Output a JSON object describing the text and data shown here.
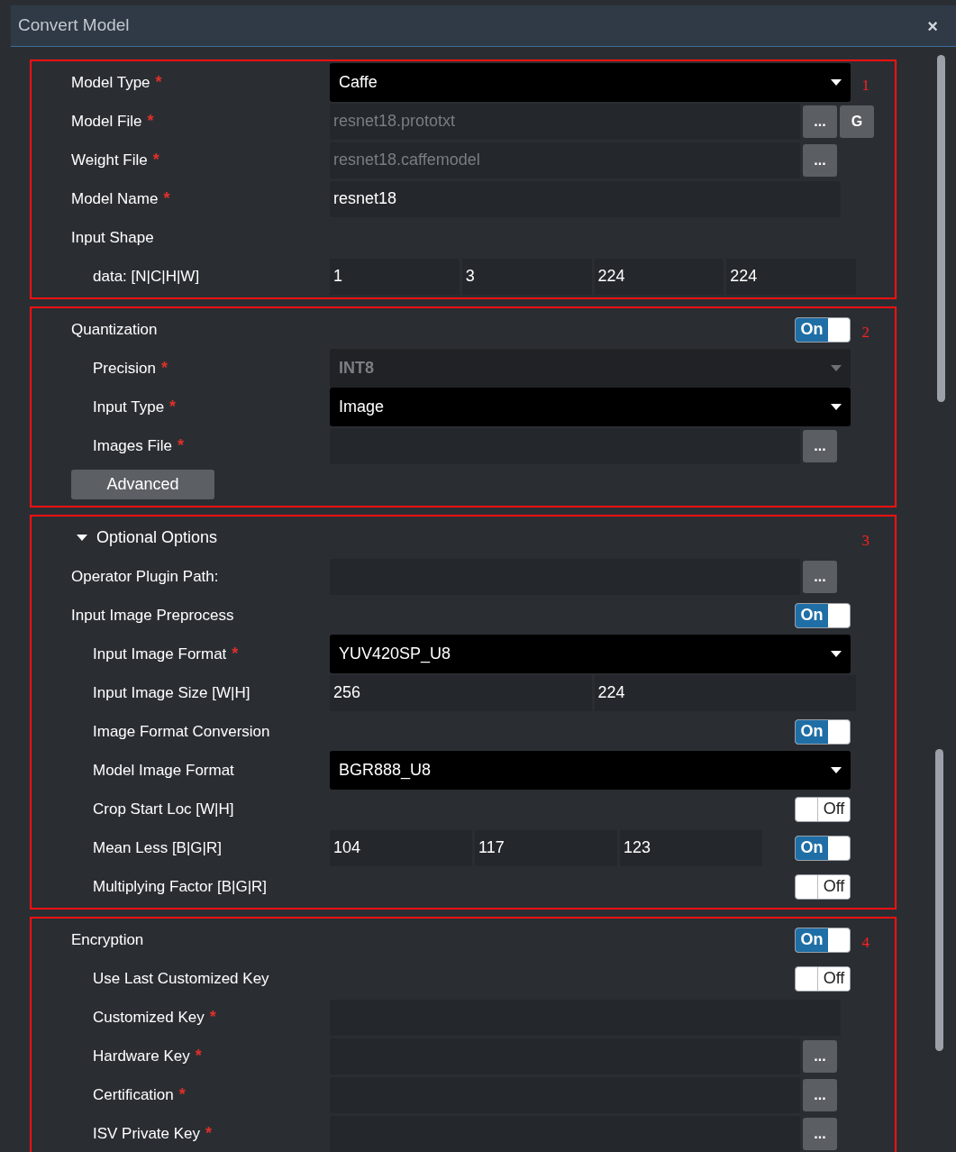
{
  "window": {
    "title": "Convert Model",
    "close": "×"
  },
  "sections": [
    {
      "number": "1",
      "rows": [
        {
          "kind": "dropdown",
          "label": "Model Type",
          "mark": "*",
          "value": "Caffe",
          "disabled": false
        },
        {
          "kind": "file",
          "label": "Model File",
          "mark": "*",
          "value": "resnet18.prototxt",
          "buttons": [
            "...",
            "G"
          ]
        },
        {
          "kind": "file",
          "label": "Weight File",
          "mark": "*",
          "value": "resnet18.caffemodel",
          "buttons": [
            "..."
          ]
        },
        {
          "kind": "text",
          "label": "Model Name",
          "mark": "*",
          "value": "resnet18"
        },
        {
          "kind": "label",
          "label": "Input Shape",
          "children": [
            {
              "kind": "values",
              "label": "data:  [N|C|H|W]",
              "values": [
                "1",
                "3",
                "224",
                "224"
              ]
            }
          ]
        }
      ]
    },
    {
      "number": "2",
      "rows": [
        {
          "kind": "toggle",
          "label": "Quantization",
          "on": true,
          "toggle_text": "On",
          "children": [
            {
              "kind": "dropdown",
              "label": "Precision",
              "mark": "*",
              "value": "INT8",
              "disabled": true
            },
            {
              "kind": "dropdown",
              "label": "Input Type",
              "mark": "*",
              "value": "Image",
              "disabled": false
            },
            {
              "kind": "file",
              "label": "Images File",
              "mark": "*",
              "buttons": [
                "..."
              ]
            }
          ]
        },
        {
          "kind": "button",
          "label": "Advanced"
        }
      ]
    },
    {
      "number": "3",
      "rows": [
        {
          "kind": "expander",
          "label": "Optional Options",
          "expanded": true,
          "children": [
            {
              "kind": "file",
              "label": "Operator Plugin Path:",
              "buttons": [
                "..."
              ]
            },
            {
              "kind": "toggle",
              "label": "Input Image Preprocess",
              "on": true,
              "toggle_text": "On",
              "children": [
                {
                  "kind": "dropdown",
                  "label": "Input Image Format",
                  "mark": "*",
                  "value": "YUV420SP_U8",
                  "disabled": false
                },
                {
                  "kind": "values",
                  "label": "Input Image Size [W|H]",
                  "values": [
                    "256",
                    "224"
                  ]
                },
                {
                  "kind": "toggle",
                  "label": "Image Format Conversion",
                  "on": true,
                  "toggle_text": "On"
                },
                {
                  "kind": "dropdown",
                  "label": "Model Image Format",
                  "value": "BGR888_U8",
                  "disabled": false
                },
                {
                  "kind": "toggle",
                  "label": "Crop Start Loc [W|H]",
                  "on": false,
                  "toggle_text": "Off"
                },
                {
                  "kind": "values",
                  "label": "Mean Less [B|G|R]",
                  "values": [
                    "104",
                    "117",
                    "123"
                  ],
                  "on": true,
                  "toggle_text": "On"
                },
                {
                  "kind": "toggle",
                  "label": "Multiplying Factor [B|G|R]",
                  "on": false,
                  "toggle_text": "Off"
                }
              ]
            }
          ]
        }
      ]
    },
    {
      "number": "4",
      "rows": [
        {
          "kind": "toggle",
          "label": "Encryption",
          "on": true,
          "toggle_text": "On",
          "children": [
            {
              "kind": "toggle",
              "label": "Use Last Customized Key",
              "on": false,
              "toggle_text": "Off"
            },
            {
              "kind": "text",
              "label": "Customized Key",
              "mark": "*"
            },
            {
              "kind": "file",
              "label": "Hardware Key",
              "mark": "*",
              "buttons": [
                "..."
              ]
            },
            {
              "kind": "file",
              "label": "Certification",
              "mark": "*",
              "buttons": [
                "..."
              ]
            },
            {
              "kind": "file",
              "label": "ISV Private Key",
              "mark": "*",
              "buttons": [
                "..."
              ]
            }
          ]
        }
      ]
    }
  ]
}
